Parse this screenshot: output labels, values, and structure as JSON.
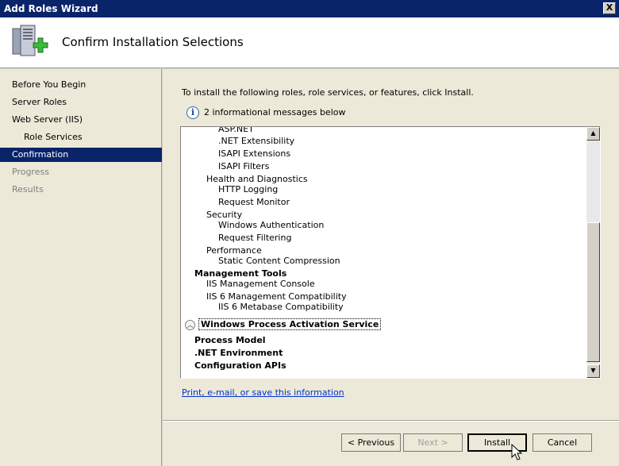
{
  "window": {
    "title": "Add Roles Wizard",
    "close_label": "X"
  },
  "header": {
    "title": "Confirm Installation Selections",
    "icon": "server-add-icon"
  },
  "sidebar": {
    "items": [
      {
        "label": "Before You Begin",
        "state": "normal"
      },
      {
        "label": "Server Roles",
        "state": "normal"
      },
      {
        "label": "Web Server (IIS)",
        "state": "normal"
      },
      {
        "label": "Role Services",
        "state": "normal",
        "sub": true
      },
      {
        "label": "Confirmation",
        "state": "active"
      },
      {
        "label": "Progress",
        "state": "disabled"
      },
      {
        "label": "Results",
        "state": "disabled"
      }
    ]
  },
  "main": {
    "instruction": "To install the following roles, role services, or features, click Install.",
    "info_message": "2 informational messages below",
    "list_lines": [
      {
        "level": 3,
        "text": "ASP.NET"
      },
      {
        "level": 3,
        "text": ".NET Extensibility"
      },
      {
        "level": 3,
        "text": "ISAPI Extensions"
      },
      {
        "level": 3,
        "text": "ISAPI Filters"
      },
      {
        "level": 2,
        "text": "Health and Diagnostics"
      },
      {
        "level": 3,
        "text": "HTTP Logging"
      },
      {
        "level": 3,
        "text": "Request Monitor"
      },
      {
        "level": 2,
        "text": "Security"
      },
      {
        "level": 3,
        "text": "Windows Authentication"
      },
      {
        "level": 3,
        "text": "Request Filtering"
      },
      {
        "level": 2,
        "text": "Performance"
      },
      {
        "level": 3,
        "text": "Static Content Compression"
      },
      {
        "level": 1,
        "text": "Management Tools"
      },
      {
        "level": 2,
        "text": "IIS Management Console"
      },
      {
        "level": 2,
        "text": "IIS 6 Management Compatibility"
      },
      {
        "level": 3,
        "text": "IIS 6 Metabase Compatibility"
      }
    ],
    "section_title": "Windows Process Activation Service",
    "section_items": [
      "Process Model",
      ".NET Environment",
      "Configuration APIs"
    ],
    "print_link": "Print, e-mail, or save this information"
  },
  "footer": {
    "previous_label": "< Previous",
    "next_label": "Next >",
    "install_label": "Install",
    "cancel_label": "Cancel"
  },
  "colors": {
    "title_bar": "#0a246a",
    "selection": "#0a246a",
    "link": "#0033cc"
  }
}
